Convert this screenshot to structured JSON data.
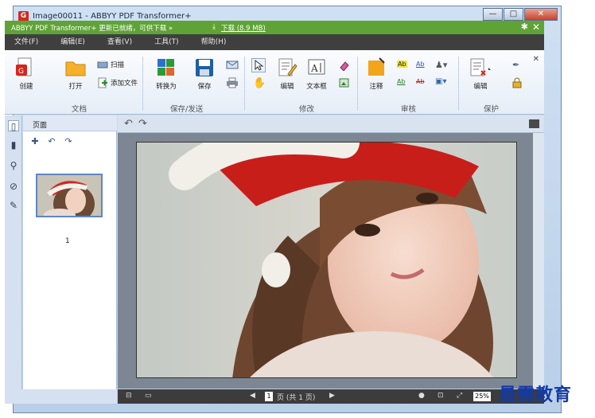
{
  "window": {
    "title": "Image00011 - ABBYY PDF Transformer+",
    "minimize": "—",
    "maximize": "□",
    "close": "✕"
  },
  "notification": {
    "message": "ABBYY PDF Transformer+ 更新已就绪，可供下载 »",
    "download_link": "下载 (8.9 MB)"
  },
  "menu": [
    "文件(F)",
    "编辑(E)",
    "查看(V)",
    "工具(T)",
    "帮助(H)"
  ],
  "ribbon": {
    "doc_group": {
      "label": "文档",
      "create": "创建",
      "open": "打开",
      "scan": "扫描",
      "add_file": "添加文件"
    },
    "save_group": {
      "label": "保存/发送",
      "convert": "转换为",
      "save": "保存"
    },
    "edit_group": {
      "label": "修改",
      "edit": "编辑",
      "textbox": "文本框"
    },
    "review_group": {
      "label": "审核",
      "annotate": "注释",
      "ab": "Ab"
    },
    "protect_group": {
      "label": "保护",
      "edit": "编辑"
    }
  },
  "pages_panel": {
    "tab_label": "页面",
    "page_number": "1"
  },
  "status": {
    "page_current": "1",
    "page_text": "页 (共 1 页)",
    "zoom": "25%"
  },
  "watermark": "最需教育",
  "colors": {
    "notify_green": "#5fa336",
    "menubar": "#3f3f3f",
    "accent_blue": "#5e86c2"
  }
}
